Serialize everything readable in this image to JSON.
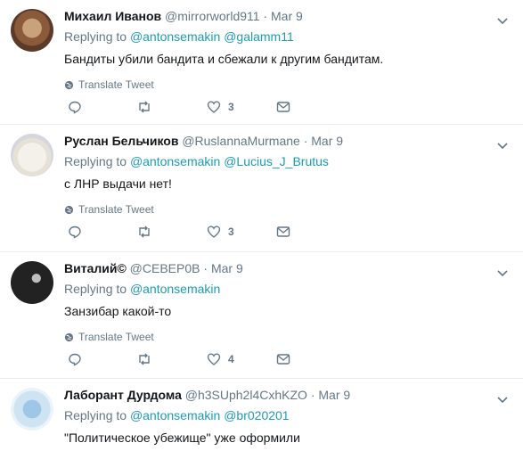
{
  "labels": {
    "replying_to": "Replying to",
    "translate": "Translate Tweet",
    "dot": "·"
  },
  "tweets": [
    {
      "name": "Михаил Иванов",
      "handle": "@mirrorworld911",
      "date": "Mar 9",
      "mentions": [
        "@antonsemakin",
        "@galamm11"
      ],
      "text": "Бандиты убили бандита  и сбежали к другим бандитам.",
      "likes": "3"
    },
    {
      "name": "Руслан Бельчиков",
      "handle": "@RuslannaMurmane",
      "date": "Mar 9",
      "mentions": [
        "@antonsemakin",
        "@Lucius_J_Brutus"
      ],
      "text": "с ЛНР выдачи нет!",
      "likes": "3"
    },
    {
      "name": "Виталий©",
      "handle": "@СЕВЕР0В",
      "date": "Mar 9",
      "mentions": [
        "@antonsemakin"
      ],
      "text": "Занзибар какой-то",
      "likes": "4"
    },
    {
      "name": "Лаборант Дурдома",
      "handle": "@h3SUph2l4CxhKZO",
      "date": "Mar 9",
      "mentions": [
        "@antonsemakin",
        "@br020201"
      ],
      "text": "\"Политическое убежище\" уже оформили",
      "likes": ""
    }
  ]
}
